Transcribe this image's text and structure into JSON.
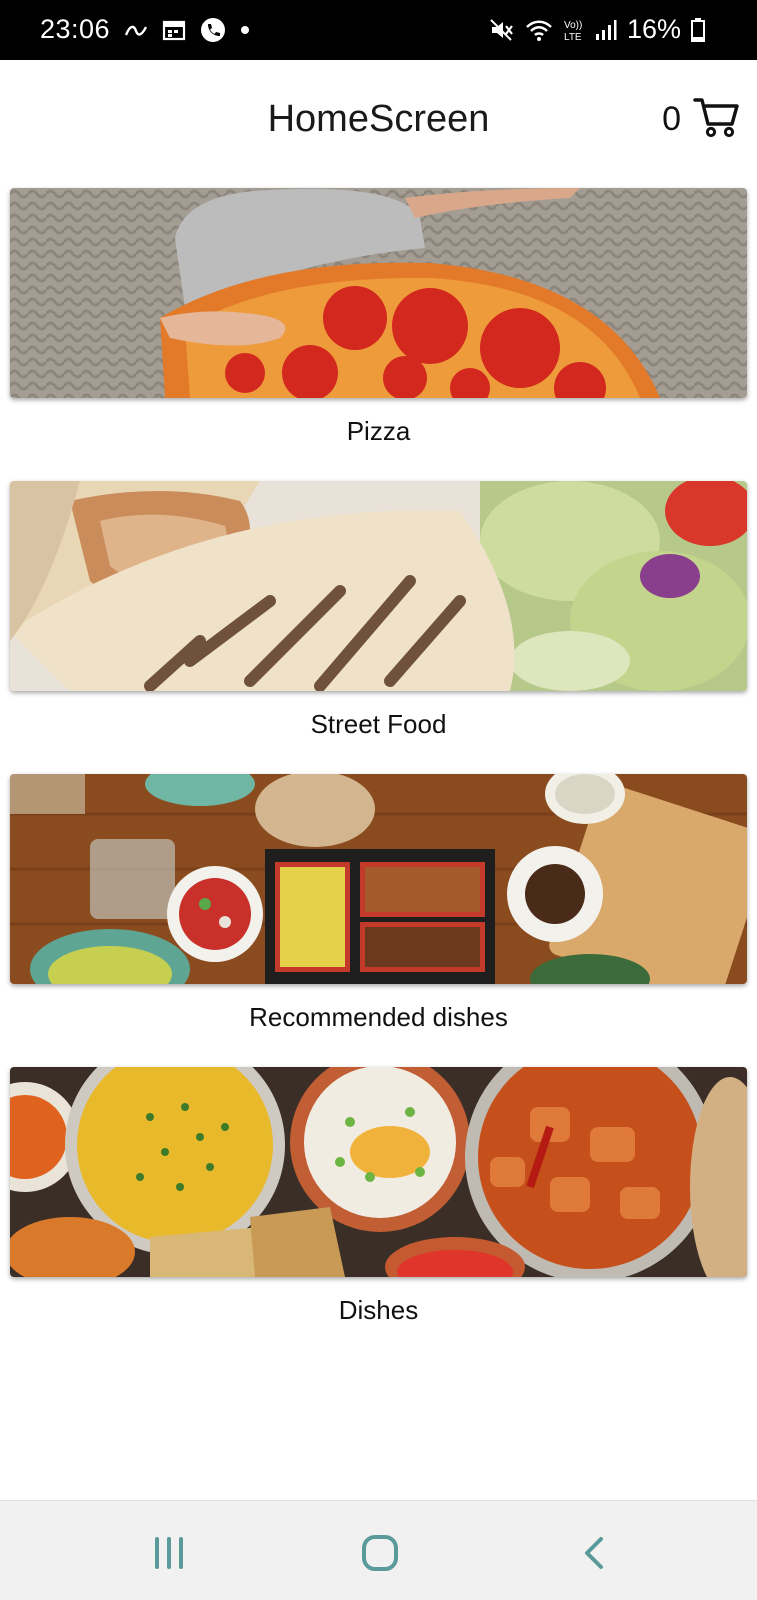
{
  "status_bar": {
    "time": "23:06",
    "battery_percent": "16%",
    "left_icons": [
      "link-icon",
      "calendar-icon",
      "phone-call-icon",
      "dot-icon"
    ],
    "right_icons": [
      "mute-icon",
      "wifi-icon",
      "volte-icon",
      "signal-icon",
      "battery-icon"
    ],
    "volte_label": "VoLTE"
  },
  "header": {
    "title": "HomeScreen",
    "cart_count": "0",
    "cart_icon": "cart-icon"
  },
  "categories": [
    {
      "label": "Pizza"
    },
    {
      "label": "Street Food"
    },
    {
      "label": "Recommended dishes"
    },
    {
      "label": "Dishes"
    }
  ],
  "nav_bar": {
    "icons": [
      "recent-apps-icon",
      "home-icon",
      "back-icon"
    ],
    "icon_color": "#5a9a9a"
  }
}
